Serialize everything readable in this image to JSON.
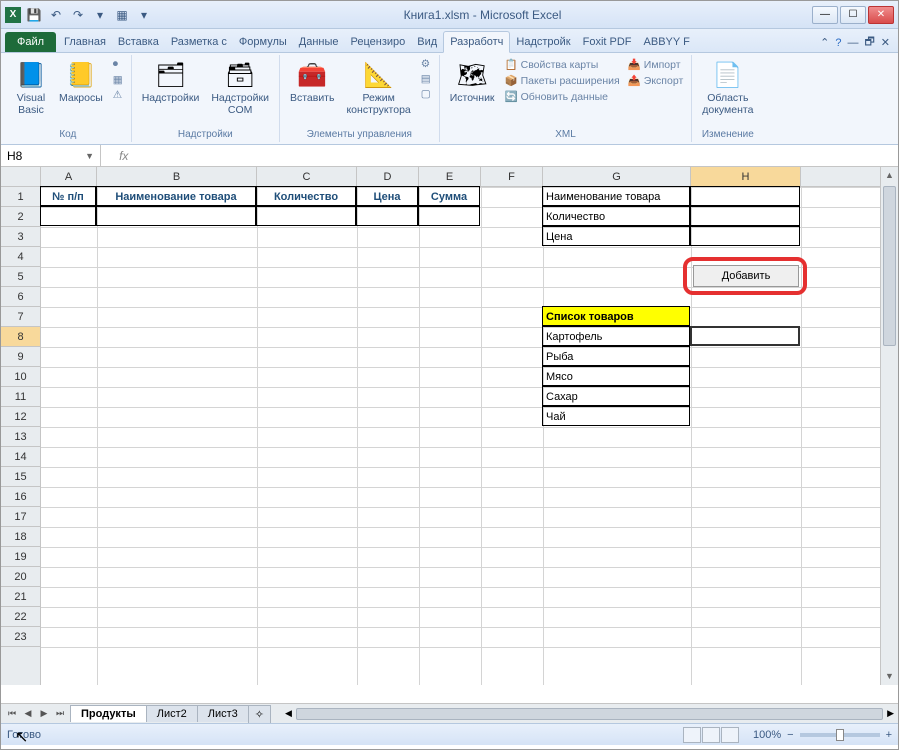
{
  "window": {
    "title": "Книга1.xlsm  -  Microsoft Excel"
  },
  "qat": [
    "save-icon",
    "undo-icon",
    "redo-icon",
    "more-icon",
    "more2-icon"
  ],
  "ribbon_tabs": {
    "file": "Файл",
    "items": [
      "Главная",
      "Вставка",
      "Разметка с",
      "Формулы",
      "Данные",
      "Рецензиро",
      "Вид",
      "Разработч",
      "Надстройк",
      "Foxit PDF",
      "ABBYY F"
    ],
    "active_index": 7
  },
  "ribbon": {
    "groups": {
      "code": {
        "label": "Код",
        "buttons": {
          "vb": "Visual\nBasic",
          "macros": "Макросы"
        }
      },
      "addins": {
        "label": "Надстройки",
        "buttons": {
          "addins": "Надстройки",
          "com": "Надстройки\nCOM"
        }
      },
      "controls": {
        "label": "Элементы управления",
        "buttons": {
          "insert": "Вставить",
          "design": "Режим\nконструктора"
        }
      },
      "xml": {
        "label": "XML",
        "buttons": {
          "source": "Источник"
        },
        "rows": {
          "map": "Свойства карты",
          "pkg": "Пакеты расширения",
          "refresh": "Обновить данные",
          "import": "Импорт",
          "export": "Экспорт"
        }
      },
      "modify": {
        "label": "Изменение",
        "buttons": {
          "docarea": "Область\nдокумента"
        }
      }
    }
  },
  "formula_bar": {
    "name_box": "H8",
    "fx": "fx",
    "value": ""
  },
  "columns": [
    {
      "letter": "A",
      "width": 56
    },
    {
      "letter": "B",
      "width": 160
    },
    {
      "letter": "C",
      "width": 100
    },
    {
      "letter": "D",
      "width": 62
    },
    {
      "letter": "E",
      "width": 62
    },
    {
      "letter": "F",
      "width": 62
    },
    {
      "letter": "G",
      "width": 148
    },
    {
      "letter": "H",
      "width": 110
    }
  ],
  "selected_col_index": 7,
  "row_count": 23,
  "selected_row": 8,
  "cells": {
    "headers": {
      "A1": "№ п/п",
      "B1": "Наименование товара",
      "C1": "Количество",
      "D1": "Цена",
      "E1": "Сумма"
    },
    "side_labels": {
      "G1": "Наименование товара",
      "G2": "Количество",
      "G3": "Цена"
    },
    "button_label": "Добавить",
    "list_header": "Список товаров",
    "list_items": [
      "Картофель",
      "Рыба",
      "Мясо",
      "Сахар",
      "Чай"
    ]
  },
  "selected_cell": "H8",
  "sheets": {
    "active": "Продукты",
    "others": [
      "Лист2",
      "Лист3"
    ]
  },
  "statusbar": {
    "ready": "Готово",
    "zoom": "100%"
  }
}
